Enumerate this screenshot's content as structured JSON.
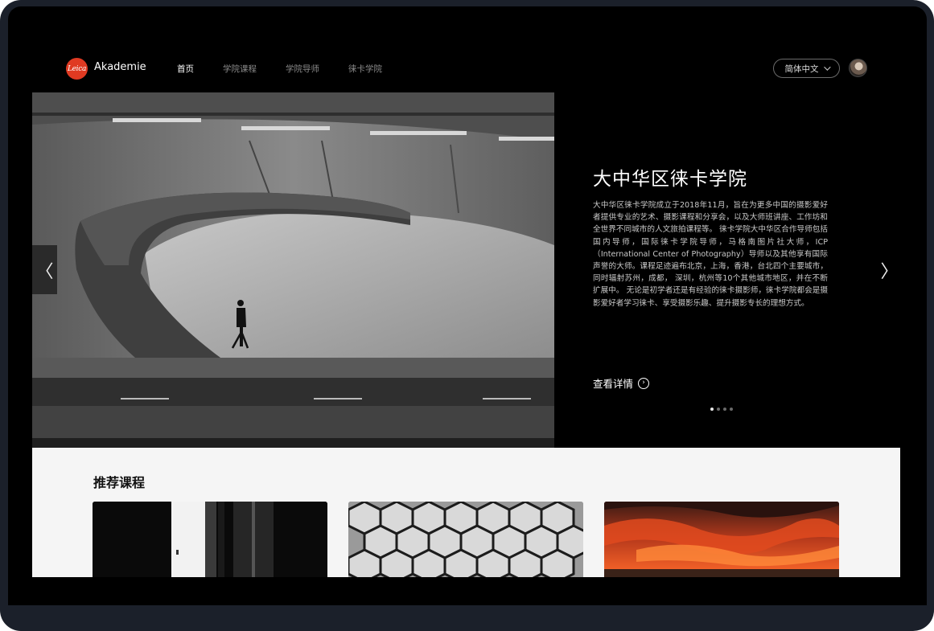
{
  "nav": {
    "logo_text": "Leica",
    "brand": "Akademie",
    "menu": [
      {
        "label": "首页",
        "active": true
      },
      {
        "label": "学院课程",
        "active": false
      },
      {
        "label": "学院导师",
        "active": false
      },
      {
        "label": "徕卡学院",
        "active": false
      }
    ],
    "language": "简体中文"
  },
  "hero": {
    "title": "大中华区徕卡学院",
    "description": "大中华区徕卡学院成立于2018年11月，旨在为更多中国的摄影爱好者提供专业的艺术、摄影课程和分享会，以及大师班讲座、工作坊和全世界不同城市的人文旅拍课程等。 徕卡学院大中华区合作导师包括国内导师，国际徕卡学院导师，马格南图片社大师，ICP（International Center of Photography）导师以及其他享有国际声誉的大师。课程足迹遍布北京，上海，香港，台北四个主要城市，同时辐射苏州，成都， 深圳，杭州等10个其他城市地区，并在不断扩展中。 无论是初学者还是有经验的徕卡摄影师，徕卡学院都会是摄影爱好者学习徕卡、享受摄影乐趣、提升摄影专长的理想方式。",
    "more_label": "查看详情",
    "arrow_left": "〈",
    "arrow_right": "〉",
    "slides_total": 4,
    "slide_active": 1
  },
  "courses": {
    "title": "推荐课程"
  },
  "colors": {
    "brand_red": "#e03a22",
    "background": "#000000",
    "frame": "#1b202a"
  }
}
